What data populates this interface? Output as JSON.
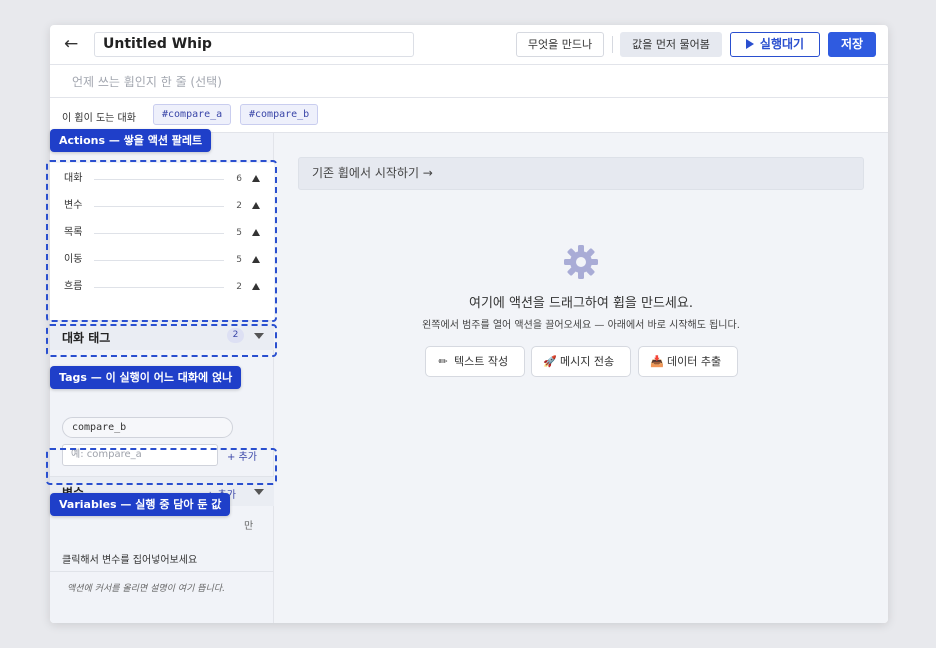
{
  "topbar": {
    "back_icon": "←",
    "title_value": "Untitled Whip",
    "make_label": "무엇을 만드나",
    "ask_label": "값을 먼저 물어봄",
    "run_label": "실행대기",
    "save_label": "저장"
  },
  "description": {
    "placeholder": "언제 쓰는 휩인지 한 줄 (선택)"
  },
  "conversations": {
    "label": "이 휩이 도는 대화",
    "chips": [
      "#compare_a",
      "#compare_b"
    ]
  },
  "palette": {
    "annotation": "Actions — 쌓을 액션 팔레트",
    "items": [
      {
        "name": "대화",
        "count": "6"
      },
      {
        "name": "변수",
        "count": "2"
      },
      {
        "name": "목록",
        "count": "5"
      },
      {
        "name": "이동",
        "count": "5"
      },
      {
        "name": "흐름",
        "count": "2"
      }
    ]
  },
  "tags": {
    "title": "대화 태그",
    "badge": "2",
    "annotation": "Tags — 이 실행이 어느 대화에 얹나",
    "chip": "compare_b",
    "input_placeholder": "예: compare_a",
    "add_label": "+ 추가"
  },
  "variables": {
    "title": "변수",
    "add_label": "+ 추가",
    "annotation": "Variables — 실행 중 담아 둔 값",
    "hint_cut": "만",
    "hint": "클릭해서 변수를 집어넣어보세요"
  },
  "sidebar_footer": "액션에 커서를 올리면 설명이 여기 뜹니다.",
  "main": {
    "start_label": "기존 휩에서 시작하기 →",
    "empty_title": "여기에 액션을 드래그하여 휩을 만드세요.",
    "empty_sub": "왼쪽에서 범주를 열어 액션을 끌어오세요 — 아래에서 바로 시작해도 됩니다.",
    "quick_buttons": [
      {
        "icon": "pencil-icon",
        "glyph": "✏",
        "label": "텍스트 작성"
      },
      {
        "icon": "rocket-icon",
        "glyph": "🚀",
        "label": "메시지 전송"
      },
      {
        "icon": "inbox-icon",
        "glyph": "📥",
        "label": "데이터 추출"
      }
    ]
  },
  "colors": {
    "accent": "#2f5be0",
    "annotation": "#1f3fc9"
  }
}
